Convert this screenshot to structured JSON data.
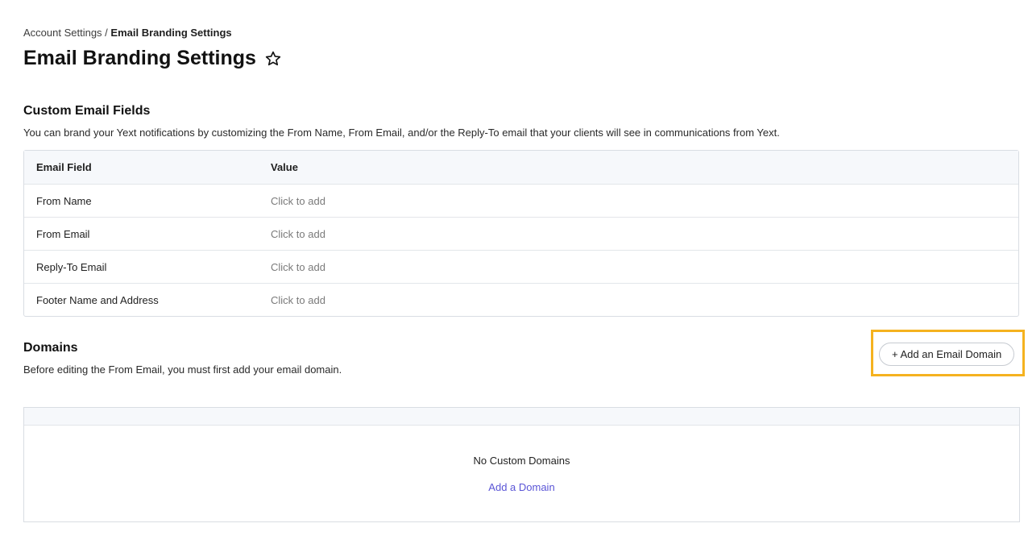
{
  "breadcrumb": {
    "parent": "Account Settings",
    "separator": " / ",
    "current": "Email Branding Settings"
  },
  "page": {
    "title": "Email Branding Settings",
    "favorite_icon": "star-outline-icon"
  },
  "custom_fields": {
    "title": "Custom Email Fields",
    "description": "You can brand your Yext notifications by customizing the From Name, From Email, and/or the Reply-To email that your clients will see in communications from Yext.",
    "columns": [
      "Email Field",
      "Value"
    ],
    "rows": [
      {
        "field": "From Name",
        "value": "Click to add"
      },
      {
        "field": "From Email",
        "value": "Click to add"
      },
      {
        "field": "Reply-To Email",
        "value": "Click to add"
      },
      {
        "field": "Footer Name and Address",
        "value": "Click to add"
      }
    ]
  },
  "domains": {
    "title": "Domains",
    "description": "Before editing the From Email, you must first add your email domain.",
    "add_button_label": "+ Add an Email Domain",
    "empty_title": "No Custom Domains",
    "empty_link": "Add a Domain"
  },
  "colors": {
    "link": "#5a55d6",
    "highlight": "#f5b21f",
    "table_header_bg": "#f6f8fb"
  }
}
